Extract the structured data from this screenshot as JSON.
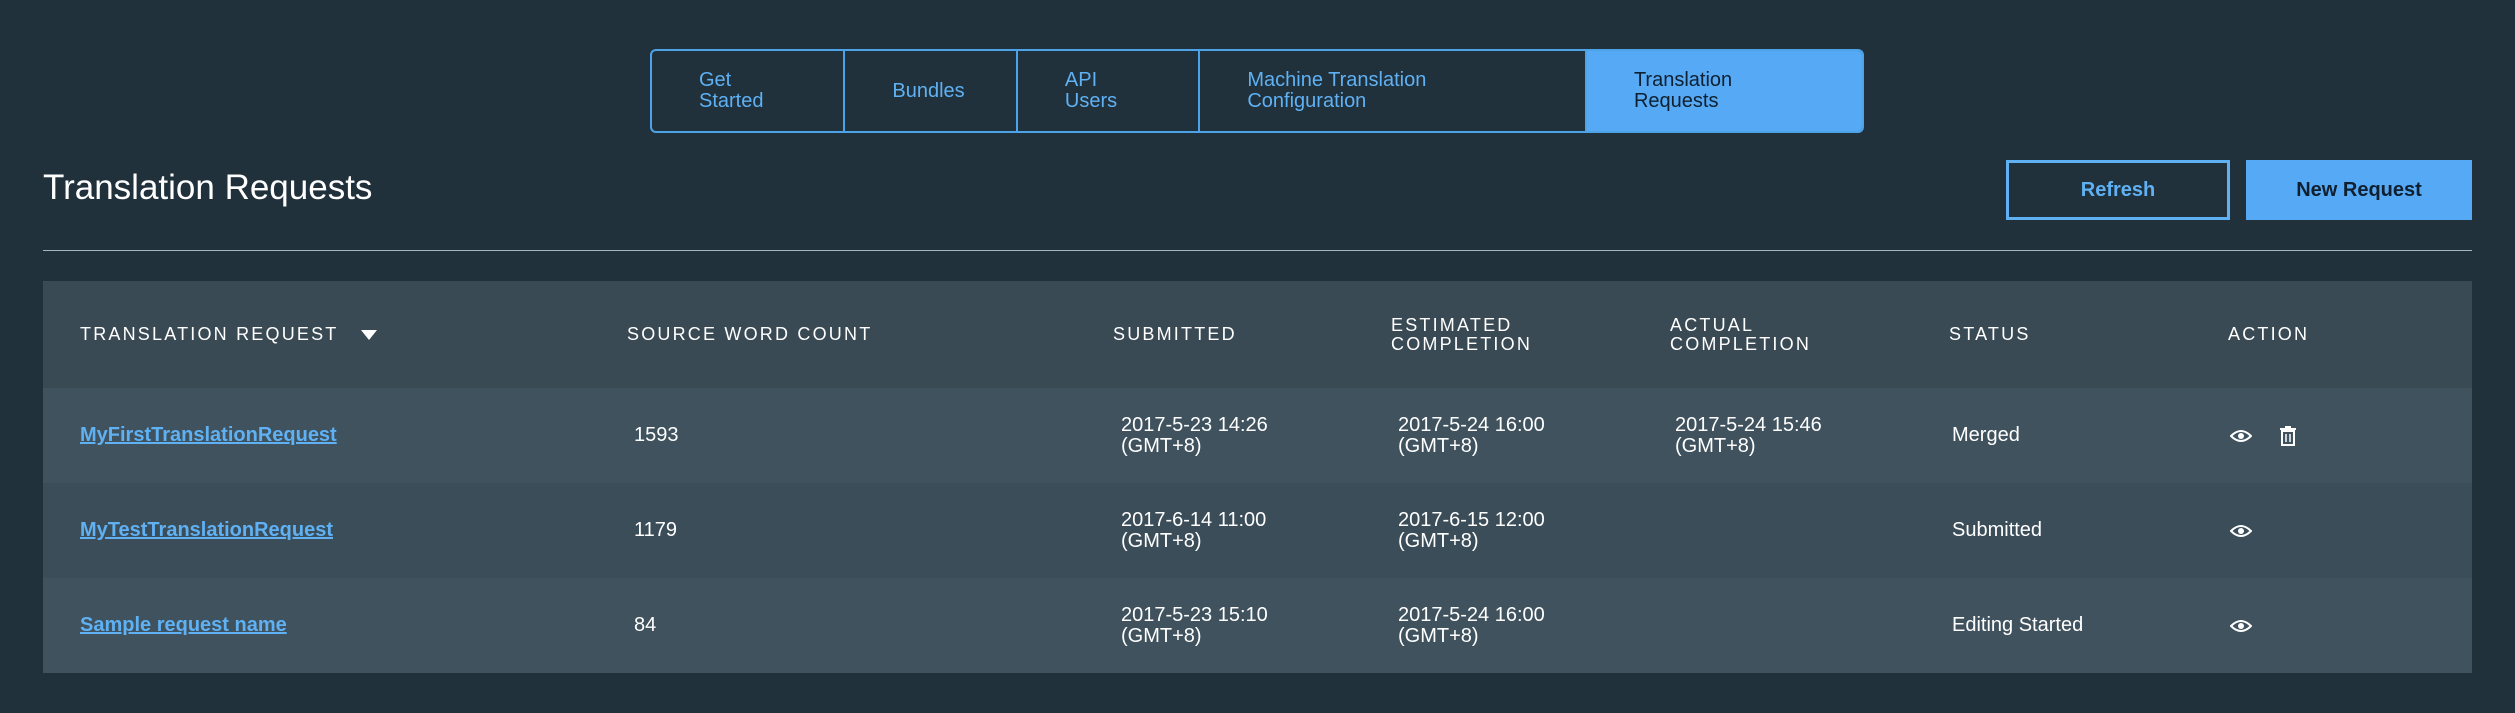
{
  "tabs": [
    {
      "label": "Get\nStarted",
      "width": 194
    },
    {
      "label": "Bundles",
      "width": 173
    },
    {
      "label": "API\nUsers",
      "width": 183
    },
    {
      "label": "Machine Translation\nConfiguration",
      "width": 388
    },
    {
      "label": "Translation\nRequests",
      "width": 276
    }
  ],
  "active_tab": 4,
  "page": {
    "title": "Translation Requests",
    "refresh_label": "Refresh",
    "new_request_label": "New Request"
  },
  "table": {
    "headers": {
      "request": "TRANSLATION REQUEST",
      "word_count": "SOURCE WORD COUNT",
      "submitted": "SUBMITTED",
      "estimated": "ESTIMATED\nCOMPLETION",
      "actual": "ACTUAL\nCOMPLETION",
      "status": "STATUS",
      "action": "ACTION"
    },
    "rows": [
      {
        "name": "MyFirstTranslationRequest",
        "word_count": "1593",
        "submitted": "2017-5-23 14:26\n(GMT+8)",
        "estimated": "2017-5-24 16:00\n(GMT+8)",
        "actual": "2017-5-24 15:46\n(GMT+8)",
        "status": "Merged",
        "actions": [
          "eye-icon",
          "trash-icon"
        ]
      },
      {
        "name": "MyTestTranslationRequest",
        "word_count": "1179",
        "submitted": "2017-6-14 11:00\n(GMT+8)",
        "estimated": "2017-6-15 12:00\n(GMT+8)",
        "actual": "",
        "status": "Submitted",
        "actions": [
          "eye-icon"
        ]
      },
      {
        "name": "Sample request name",
        "word_count": "84",
        "submitted": "2017-5-23 15:10\n(GMT+8)",
        "estimated": "2017-5-24 16:00\n(GMT+8)",
        "actual": "",
        "status": "Editing Started",
        "actions": [
          "eye-icon"
        ]
      }
    ]
  },
  "colors": {
    "background": "#20313c",
    "accent": "#56a9f5",
    "header_row": "#3a4a54",
    "row": "#3f525d"
  }
}
